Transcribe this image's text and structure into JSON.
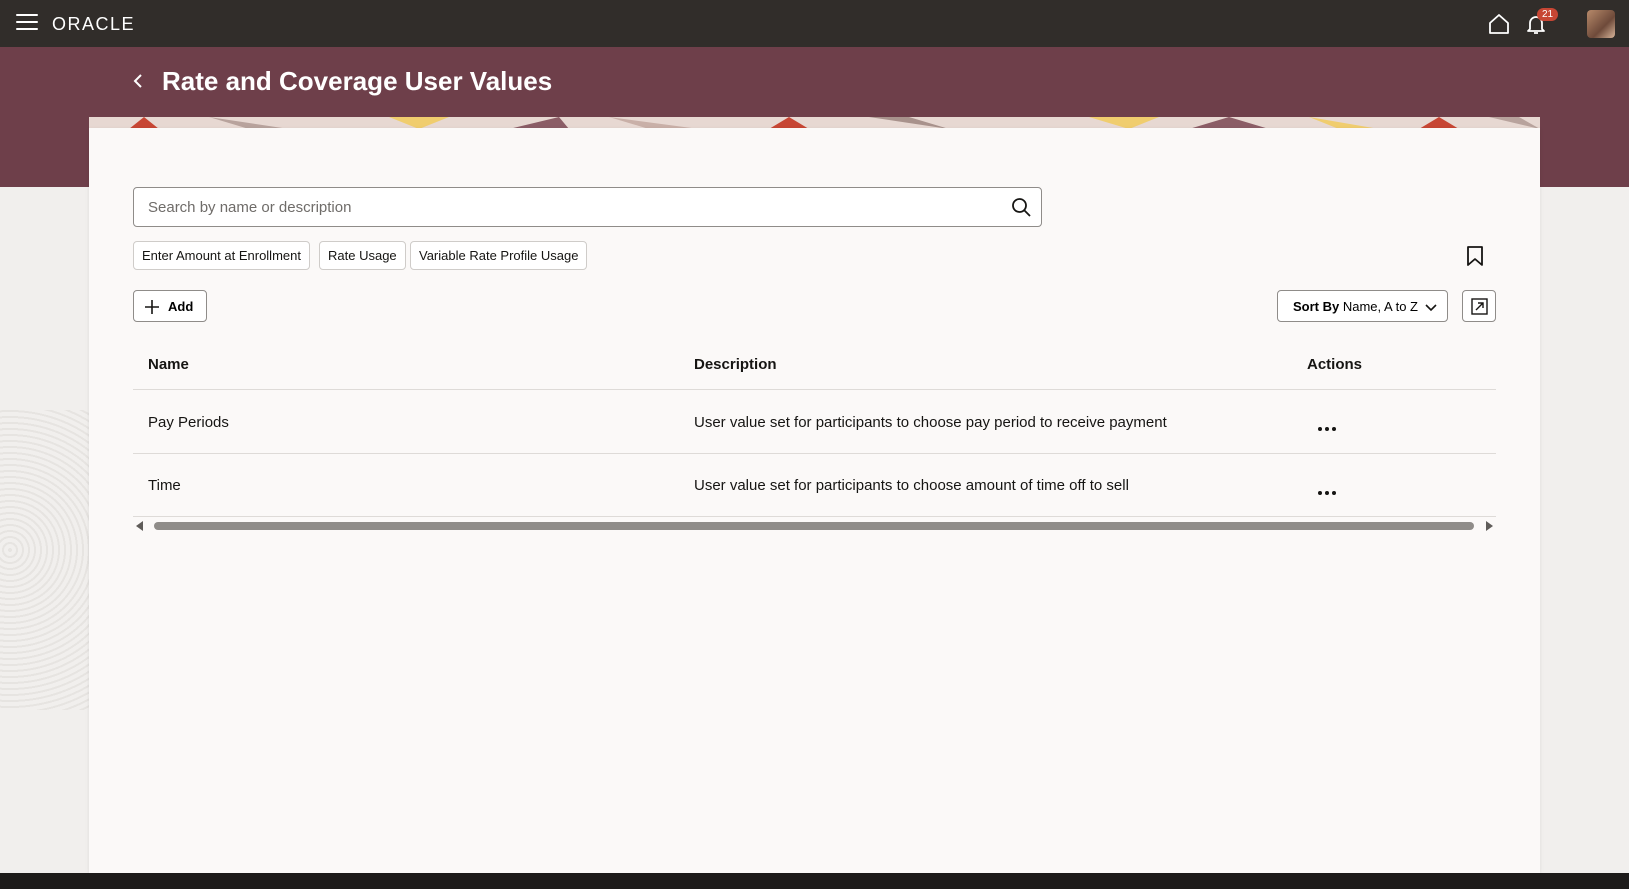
{
  "topbar": {
    "logo": "ORACLE",
    "notification_count": "21",
    "icons": [
      "menu-icon",
      "home-icon",
      "bell-icon",
      "avatar"
    ]
  },
  "header": {
    "title": "Rate and Coverage User Values"
  },
  "search": {
    "placeholder": "Search by name or description"
  },
  "filters": [
    {
      "label": "Enter Amount at Enrollment"
    },
    {
      "label": "Rate Usage"
    },
    {
      "label": "Variable Rate Profile Usage"
    }
  ],
  "toolbar": {
    "add_label": "Add",
    "sort_prefix": "Sort By",
    "sort_value": "Name, A to Z"
  },
  "table": {
    "columns": [
      "Name",
      "Description",
      "Actions"
    ],
    "rows": [
      {
        "name": "Pay Periods",
        "description": "User value set for participants to choose pay period to receive payment"
      },
      {
        "name": "Time",
        "description": "User value set for participants to choose amount of time off to sell"
      }
    ]
  },
  "colors": {
    "topbar": "#312d2a",
    "header_band": "#6e3f4a",
    "badge": "#c74634"
  }
}
